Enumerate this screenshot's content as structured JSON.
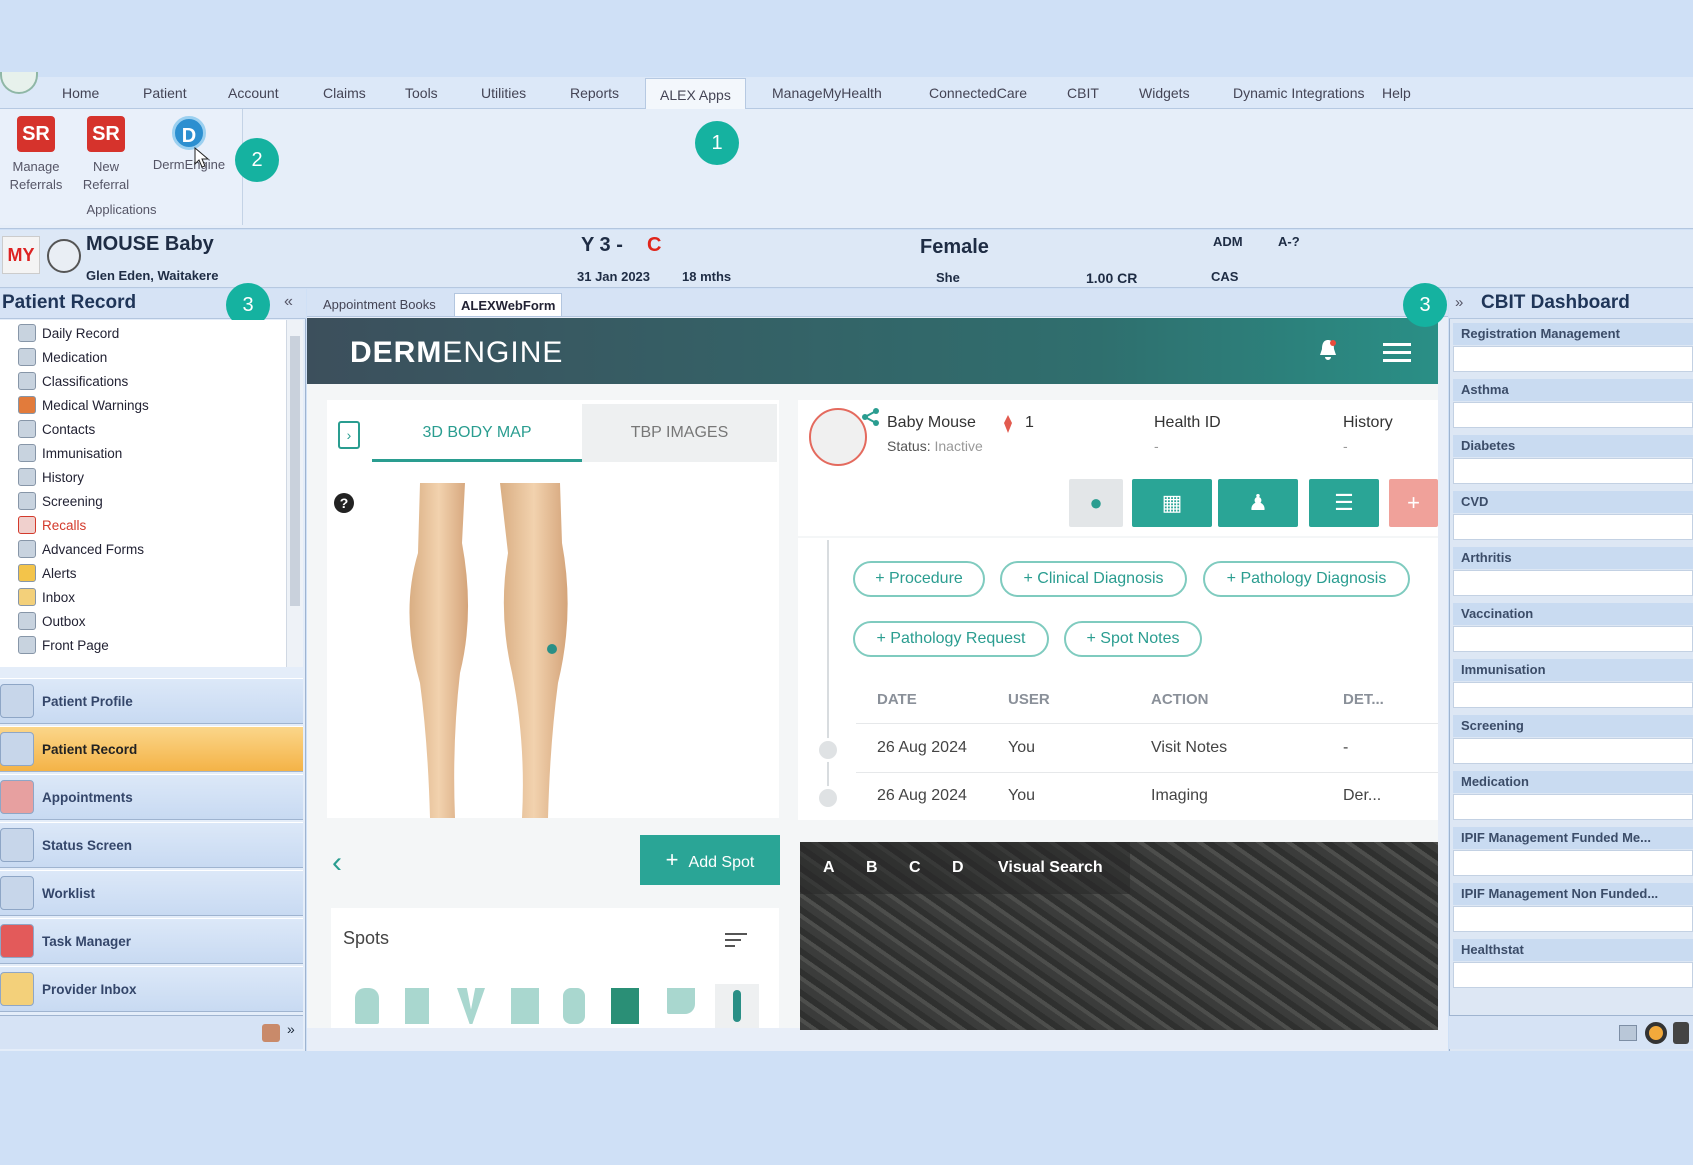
{
  "menu": {
    "items": [
      "Home",
      "Patient",
      "Account",
      "Claims",
      "Tools",
      "Utilities",
      "Reports",
      "ALEX Apps",
      "ManageMyHealth",
      "ConnectedCare",
      "CBIT",
      "Widgets",
      "Dynamic Integrations",
      "Help"
    ],
    "active": "ALEX Apps"
  },
  "ribbon": {
    "manage_referrals": "Manage Referrals",
    "new_referral": "New Referral",
    "dermengine": "DermEngine",
    "group_label": "Applications"
  },
  "callouts": [
    "1",
    "2",
    "3",
    "3"
  ],
  "patient": {
    "name": "MOUSE Baby",
    "location": "Glen Eden, Waitakere",
    "age_code": "Y 3 -",
    "flag": "C",
    "dob": "31 Jan 2023",
    "age": "18 mths",
    "gender": "Female",
    "pronoun": "She",
    "cr": "1.00 CR",
    "adm": "ADM",
    "a_code": "A-?",
    "cas": "CAS"
  },
  "left_panel": {
    "title": "Patient Record",
    "tree": [
      "Daily Record",
      "Medication",
      "Classifications",
      "Medical Warnings",
      "Contacts",
      "Immunisation",
      "History",
      "Screening",
      "Recalls",
      "Advanced Forms",
      "Alerts",
      "Inbox",
      "Outbox",
      "Front Page"
    ],
    "nav": [
      "Patient Profile",
      "Patient Record",
      "Appointments",
      "Status Screen",
      "Worklist",
      "Task Manager",
      "Provider Inbox"
    ],
    "active_nav": "Patient Record"
  },
  "tabs": [
    "Appointment Books",
    "ALEXWebForm"
  ],
  "derm": {
    "logo_a": "DERM",
    "logo_b": "ENGINE",
    "tab_bodymap": "3D BODY MAP",
    "tab_tbp": "TBP IMAGES",
    "help": "?",
    "add_spot": "Add Spot",
    "spots_title": "Spots",
    "patient_name": "Baby Mouse",
    "status_label": "Status:",
    "status_value": "Inactive",
    "spot_count": "1",
    "health_id_label": "Health ID",
    "health_id_value": "-",
    "history_label": "History",
    "history_value": "-",
    "pills": [
      "+ Procedure",
      "+ Clinical Diagnosis",
      "+ Pathology Diagnosis",
      "+ Pathology Request",
      "+ Spot Notes"
    ],
    "table_headers": [
      "DATE",
      "USER",
      "ACTION",
      "DET..."
    ],
    "rows": [
      {
        "date": "26 Aug 2024",
        "user": "You",
        "action": "Visit Notes",
        "det": "-"
      },
      {
        "date": "26 Aug 2024",
        "user": "You",
        "action": "Imaging",
        "det": "Der..."
      }
    ],
    "image_labels": [
      "A",
      "B",
      "C",
      "D"
    ],
    "visual_search": "Visual Search"
  },
  "right_panel": {
    "title": "CBIT Dashboard",
    "sections": [
      "Registration Management",
      "Asthma",
      "Diabetes",
      "CVD",
      "Arthritis",
      "Vaccination",
      "Immunisation",
      "Screening",
      "Medication",
      "IPIF Management Funded Me...",
      "IPIF Management Non Funded...",
      "Healthstat"
    ]
  }
}
